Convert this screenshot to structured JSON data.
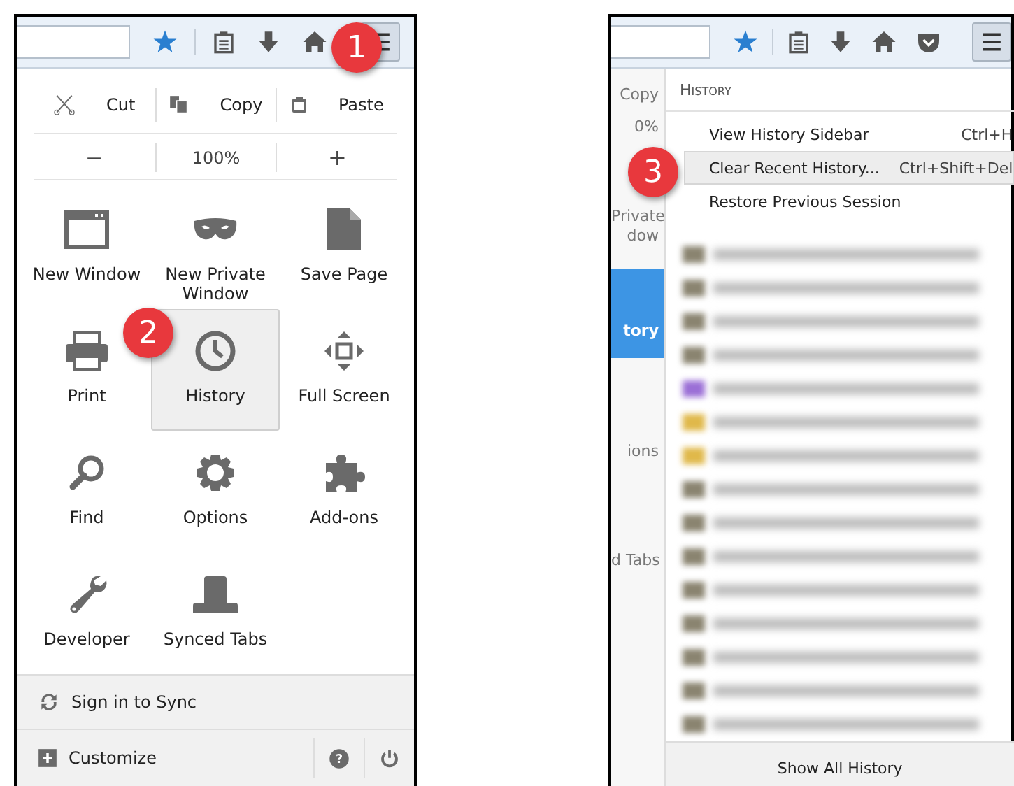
{
  "left_window": {
    "edit_row": [
      {
        "label": "Cut"
      },
      {
        "label": "Copy"
      },
      {
        "label": "Paste"
      }
    ],
    "zoom_row": {
      "zoom_out": "−",
      "zoom_level": "100%",
      "zoom_in": "+"
    },
    "menu_items": [
      {
        "label": "New Window",
        "selected": false
      },
      {
        "label": "New Private Window",
        "selected": false
      },
      {
        "label": "Save Page",
        "selected": false
      },
      {
        "label": "Print",
        "selected": false
      },
      {
        "label": "History",
        "selected": true
      },
      {
        "label": "Full Screen",
        "selected": false
      },
      {
        "label": "Find",
        "selected": false
      },
      {
        "label": "Options",
        "selected": false
      },
      {
        "label": "Add-ons",
        "selected": false
      },
      {
        "label": "Developer",
        "selected": false
      },
      {
        "label": "Synced Tabs",
        "selected": false
      }
    ],
    "sign_in": "Sign in to Sync",
    "customize": "Customize",
    "help": "?"
  },
  "right_window": {
    "side_strip": [
      {
        "label": "Copy",
        "selected": false
      },
      {
        "label": "0%",
        "selected": false
      },
      {
        "label": "Private\ndow",
        "selected": false
      },
      {
        "label": "tory",
        "selected": true
      },
      {
        "label": "ions",
        "selected": false
      },
      {
        "label": "d Tabs",
        "selected": false
      }
    ],
    "history_header": "History",
    "history_items": [
      {
        "label": "View History Sidebar",
        "shortcut": "Ctrl+H",
        "selected": false
      },
      {
        "label": "Clear Recent History...",
        "shortcut": "Ctrl+Shift+Del",
        "selected": true
      },
      {
        "label": "Restore Previous Session",
        "selected": false
      }
    ],
    "blurred_entries": [
      {
        "color": "#8a8470"
      },
      {
        "color": "#8a8470"
      },
      {
        "color": "#8a8470"
      },
      {
        "color": "#8a8470"
      },
      {
        "color": "#9b6fd6"
      },
      {
        "color": "#e0b84a"
      },
      {
        "color": "#e0b84a"
      },
      {
        "color": "#8a8470"
      },
      {
        "color": "#8a8470"
      },
      {
        "color": "#8a8470"
      },
      {
        "color": "#8a8470"
      },
      {
        "color": "#8a8470"
      },
      {
        "color": "#8a8470"
      },
      {
        "color": "#8a8470"
      },
      {
        "color": "#8a8470"
      }
    ],
    "show_all": "Show All History"
  },
  "step_badges": [
    "1",
    "2",
    "3"
  ]
}
